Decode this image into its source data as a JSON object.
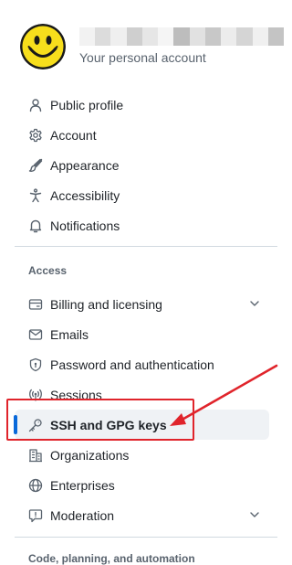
{
  "account": {
    "subtitle": "Your personal account",
    "username_blur_colors": [
      "#f2f2f2",
      "#dcdcdc",
      "#efefef",
      "#cfcfcf",
      "#e6e6e6",
      "#f5f5f5",
      "#bdbdbd",
      "#e1e1e1",
      "#c8c8c8",
      "#ececec",
      "#d5d5d5",
      "#f0f0f0",
      "#c4c4c4"
    ]
  },
  "nav": {
    "items": [
      {
        "label": "Public profile",
        "icon": "person-icon"
      },
      {
        "label": "Account",
        "icon": "gear-icon"
      },
      {
        "label": "Appearance",
        "icon": "paintbrush-icon"
      },
      {
        "label": "Accessibility",
        "icon": "accessibility-icon"
      },
      {
        "label": "Notifications",
        "icon": "bell-icon"
      }
    ],
    "access_heading": "Access",
    "access_items": [
      {
        "label": "Billing and licensing",
        "icon": "credit-card-icon",
        "expandable": true
      },
      {
        "label": "Emails",
        "icon": "mail-icon"
      },
      {
        "label": "Password and authentication",
        "icon": "shield-lock-icon"
      },
      {
        "label": "Sessions",
        "icon": "broadcast-icon"
      },
      {
        "label": "SSH and GPG keys",
        "icon": "key-icon",
        "active": true
      },
      {
        "label": "Organizations",
        "icon": "organization-icon"
      },
      {
        "label": "Enterprises",
        "icon": "globe-icon"
      },
      {
        "label": "Moderation",
        "icon": "report-icon",
        "expandable": true
      }
    ],
    "code_heading": "Code, planning, and automation"
  },
  "colors": {
    "accent": "#0969da",
    "annotation": "#e0242b",
    "active_bg": "#eff2f5"
  }
}
